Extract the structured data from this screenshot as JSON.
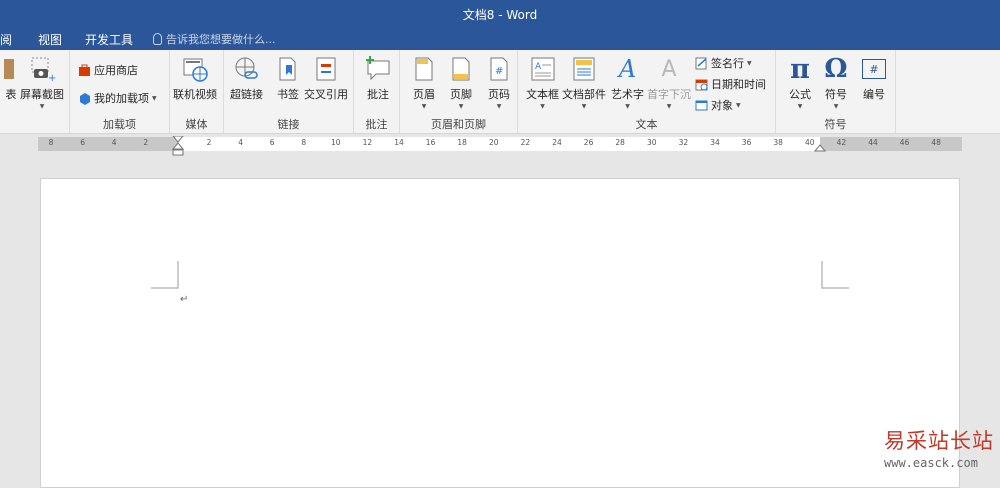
{
  "window": {
    "title": "文档8 - Word"
  },
  "tabs": [
    {
      "label": "阅"
    },
    {
      "label": "视图"
    },
    {
      "label": "开发工具"
    }
  ],
  "tellme": {
    "placeholder": "告诉我您想要做什么..."
  },
  "ribbon": {
    "illustrations_partial": {
      "left_label": "表",
      "screenshot": "屏幕截图"
    },
    "addins": {
      "store": "应用商店",
      "my_addins": "我的加载项",
      "group": "加载项"
    },
    "media": {
      "online_video": "联机视频",
      "group": "媒体"
    },
    "links": {
      "hyperlink": "超链接",
      "bookmark": "书签",
      "cross_ref": "交叉引用",
      "group": "链接"
    },
    "comments": {
      "comment": "批注",
      "group": "批注"
    },
    "header_footer": {
      "header": "页眉",
      "footer": "页脚",
      "page_number": "页码",
      "group": "页眉和页脚"
    },
    "text": {
      "textbox": "文本框",
      "quickparts": "文档部件",
      "wordart": "艺术字",
      "dropcap": "首字下沉",
      "signature": "签名行",
      "datetime": "日期和时间",
      "object": "对象",
      "group": "文本",
      "wordart_glyph": "A",
      "dropcap_glyph": "A"
    },
    "symbols": {
      "equation": "公式",
      "symbol": "符号",
      "number": "编号",
      "group": "符号",
      "equation_glyph": "π",
      "symbol_glyph": "Ω",
      "number_glyph": "#"
    }
  },
  "ruler": {
    "left_numbers": [
      "8",
      "6",
      "4",
      "2"
    ],
    "right_numbers": [
      "2",
      "4",
      "6",
      "8",
      "10",
      "12",
      "14",
      "16",
      "18",
      "20",
      "22",
      "24",
      "26",
      "28",
      "30",
      "32",
      "34",
      "36",
      "38",
      "40",
      "42",
      "44",
      "46",
      "48"
    ]
  },
  "document": {
    "paragraph_mark": "↵"
  },
  "watermark": {
    "line1": "易采站长站",
    "line2": "www.easck.com"
  },
  "colors": {
    "title_bar": "#2b579a",
    "ribbon_bg": "#f3f3f3",
    "accent_blue": "#2b579a"
  }
}
